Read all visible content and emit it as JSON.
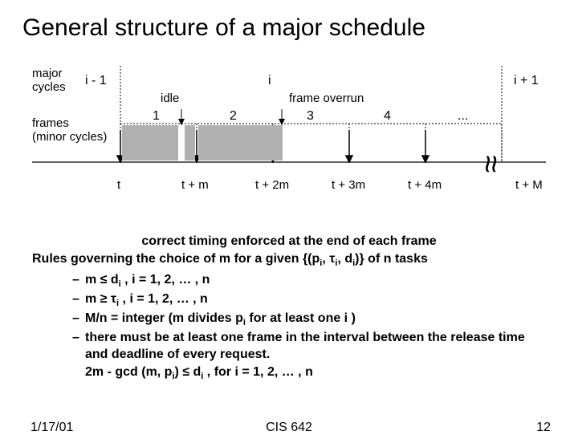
{
  "title": "General structure of a major schedule",
  "diagram": {
    "major_cycles_label": "major\ncycles",
    "cycle_prev": "i - 1",
    "cycle_curr": "i",
    "cycle_next": "i + 1",
    "idle_label": "idle",
    "overrun_label": "frame overrun",
    "frames_label": "frames\n(minor cycles)",
    "frame_nums": [
      "1",
      "2",
      "3",
      "4",
      "..."
    ],
    "ticks": [
      "t",
      "t + m",
      "t + 2m",
      "t + 3m",
      "t + 4m",
      "t + M"
    ],
    "approx": "≈"
  },
  "body": {
    "center_line": "correct timing enforced at the end of each frame",
    "rules_intro_a": "Rules governing the choice of m for a given {(p",
    "rules_intro_b": ", τ",
    "rules_intro_c": ", d",
    "rules_intro_d": ")} of n tasks",
    "b1a": "m ≤ d",
    "b1b": " , i = 1, 2, … , n",
    "b2a": "m ≥ τ",
    "b2b": " , i = 1, 2, … , n",
    "b3a": "M/n = integer  (m divides p",
    "b3b": " for at least one i )",
    "b4a": "there must be at least one frame in the interval between the release time and deadline of every request.",
    "b4b": "2m - gcd (m, p",
    "b4c": ") ≤ d",
    "b4d": " , for i = 1, 2, … , n",
    "sub_i": "i"
  },
  "footer": {
    "date": "1/17/01",
    "course": "CIS 642",
    "page": "12"
  }
}
